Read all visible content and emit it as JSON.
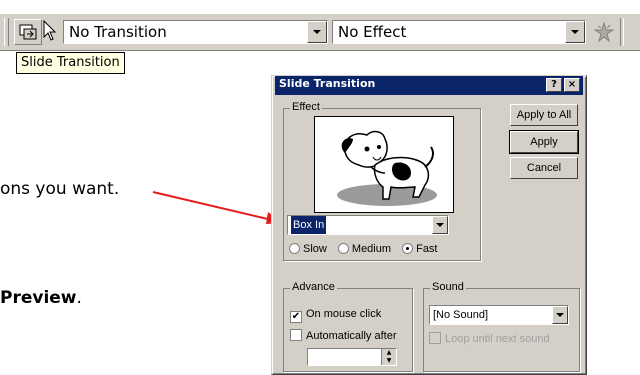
{
  "toolbar": {
    "transition_value": "No Transition",
    "effect_value": "No Effect",
    "slide_transition_icon": "slide-transition-icon",
    "animation_icon": "custom-animation-icon"
  },
  "tooltip": "Slide Transition",
  "document": {
    "line1": "ons you want.",
    "line2_bold": "Preview",
    "line2_end": "."
  },
  "dialog": {
    "title": "Slide Transition",
    "help_label": "?",
    "close_label": "×",
    "effect_group": "Effect",
    "effect_select": "Box In",
    "speeds": [
      {
        "label": "Slow",
        "selected": false
      },
      {
        "label": "Medium",
        "selected": false
      },
      {
        "label": "Fast",
        "selected": true
      }
    ],
    "buttons": {
      "apply_all": "Apply to All",
      "apply": "Apply",
      "cancel": "Cancel"
    },
    "advance_group": "Advance",
    "on_mouse_click": "On mouse click",
    "on_mouse_click_checked": "✔",
    "auto_after": "Automatically after",
    "sound_group": "Sound",
    "sound_select": "[No Sound]",
    "loop_label": "Loop until next sound"
  },
  "colors": {
    "titlebar": "#0a246a",
    "arrow": "#e51c1c",
    "face": "#d4d0c8"
  }
}
